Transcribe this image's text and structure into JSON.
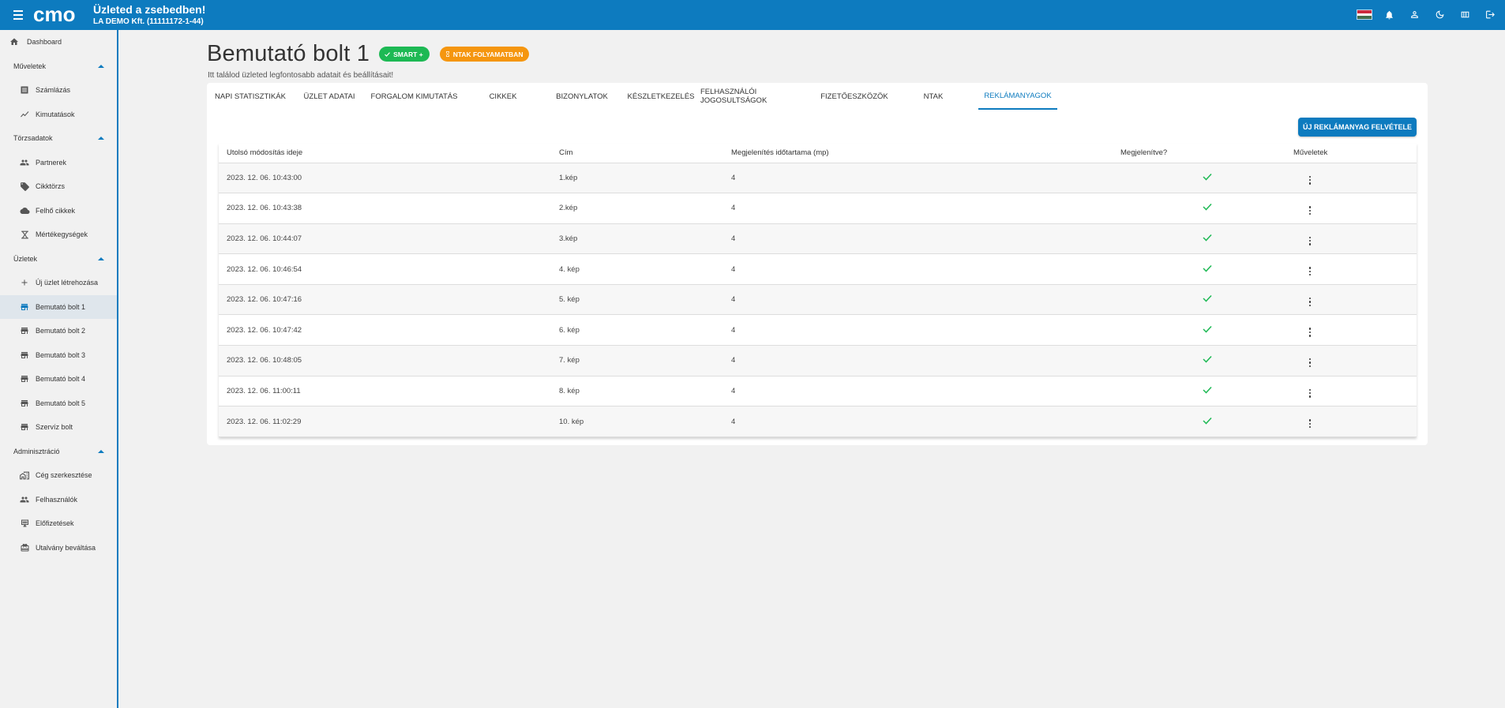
{
  "header": {
    "logo_text": "cmo",
    "title": "Üzleted a zsebedben!",
    "company": "LA DEMO Kft. (11111172-1-44)"
  },
  "colors": {
    "primary": "#0d7bbf",
    "success": "#1db954",
    "warning": "#f5960f"
  },
  "sidebar": {
    "dashboard": "Dashboard",
    "sections": {
      "muveletek": "Műveletek",
      "torzsadatok": "Törzsadatok",
      "uzletek": "Üzletek",
      "adminisztracio": "Adminisztráció"
    },
    "items": {
      "szamlazas": "Számlázás",
      "kimutatasok": "Kimutatások",
      "partnerek": "Partnerek",
      "cikktorzs": "Cikktörzs",
      "felho_cikkek": "Felhő cikkek",
      "mertekegysegek": "Mértékegységek",
      "uj_uzlet": "Új üzlet létrehozása",
      "bolt1": "Bemutató bolt 1",
      "bolt2": "Bemutató bolt 2",
      "bolt3": "Bemutató bolt 3",
      "bolt4": "Bemutató bolt 4",
      "bolt5": "Bemutató bolt 5",
      "szerviz": "Szervíz bolt",
      "ceg": "Cég szerkesztése",
      "felhasznalok": "Felhasználók",
      "elofizetesek": "Előfizetések",
      "utalvany": "Utalvány beváltása"
    }
  },
  "page": {
    "title": "Bemutató bolt 1",
    "badge_smart": "SMART +",
    "badge_ntak": "NTAK FOLYAMATBAN",
    "subtitle": "Itt találod üzleted legfontosabb adatait és beállításait!"
  },
  "tabs": [
    "NAPI STATISZTIKÁK",
    "ÜZLET ADATAI",
    "FORGALOM KIMUTATÁS",
    "CIKKEK",
    "BIZONYLATOK",
    "KÉSZLETKEZELÉS",
    "FELHASZNÁLÓI JOGOSULTSÁGOK",
    "FIZETŐESZKÖZÖK",
    "NTAK",
    "REKLÁMANYAGOK"
  ],
  "add_button": "ÚJ REKLÁMANYAG FELVÉTELE",
  "table": {
    "headers": [
      "Utolsó módosítás ideje",
      "Cím",
      "Megjelenítés időtartama (mp)",
      "Megjelenítve?",
      "Műveletek"
    ],
    "rows": [
      {
        "date": "2023. 12. 06. 10:43:00",
        "title": "1.kép",
        "duration": "4"
      },
      {
        "date": "2023. 12. 06. 10:43:38",
        "title": "2.kép",
        "duration": "4"
      },
      {
        "date": "2023. 12. 06. 10:44:07",
        "title": "3.kép",
        "duration": "4"
      },
      {
        "date": "2023. 12. 06. 10:46:54",
        "title": "4. kép",
        "duration": "4"
      },
      {
        "date": "2023. 12. 06. 10:47:16",
        "title": "5. kép",
        "duration": "4"
      },
      {
        "date": "2023. 12. 06. 10:47:42",
        "title": "6. kép",
        "duration": "4"
      },
      {
        "date": "2023. 12. 06. 10:48:05",
        "title": "7. kép",
        "duration": "4"
      },
      {
        "date": "2023. 12. 06. 11:00:11",
        "title": "8. kép",
        "duration": "4"
      },
      {
        "date": "2023. 12. 06. 11:02:29",
        "title": "10. kép",
        "duration": "4"
      }
    ]
  }
}
